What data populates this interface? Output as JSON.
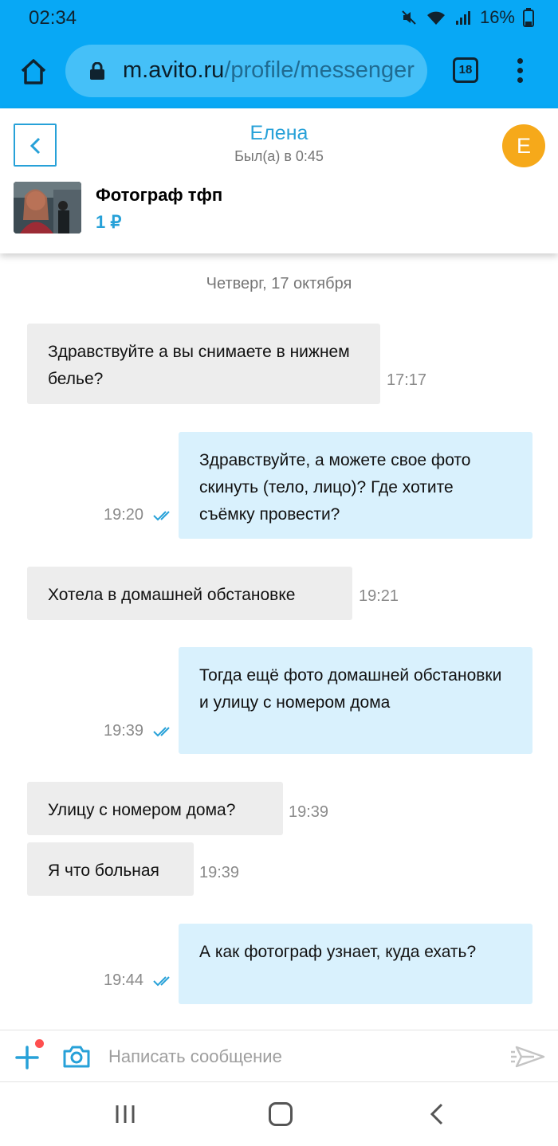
{
  "status_bar": {
    "time": "02:34",
    "battery": "16%"
  },
  "browser": {
    "url_domain": "m.avito.ru",
    "url_path": "/profile/messenger",
    "tab_count": "18"
  },
  "chat": {
    "contact_name": "Елена",
    "last_seen": "Был(а) в 0:45",
    "avatar_letter": "Е",
    "ad_title": "Фотограф тфп",
    "ad_price": "1 ₽"
  },
  "date_separator": "Четверг, 17 октября",
  "messages": [
    {
      "direction": "in",
      "text": "Здравствуйте а вы снимаете в нижнем белье?",
      "time": "17:17"
    },
    {
      "direction": "out",
      "text": "Здравствуйте, а можете свое фото скинуть (тело, лицо)? Где хотите съёмку провести?",
      "time": "19:20",
      "read": true
    },
    {
      "direction": "in",
      "text": "Хотела в домашней обстановке",
      "time": "19:21"
    },
    {
      "direction": "out",
      "text": "Тогда ещё фото домашней обстановки и улицу с номером дома",
      "time": "19:39",
      "read": true
    },
    {
      "direction": "in",
      "text": "Улицу с номером дома?",
      "time": "19:39"
    },
    {
      "direction": "in",
      "text": "Я что больная",
      "time": "19:39"
    },
    {
      "direction": "out",
      "text": "А как фотограф узнает, куда ехать?",
      "time": "19:44",
      "read": true
    }
  ],
  "composer": {
    "placeholder": "Написать сообщение"
  },
  "colors": {
    "brand_blue": "#08a8f5",
    "accent": "#27a1d8",
    "incoming_bubble": "#ededed",
    "outgoing_bubble": "#d9f1fd",
    "avatar": "#f6a91a"
  }
}
